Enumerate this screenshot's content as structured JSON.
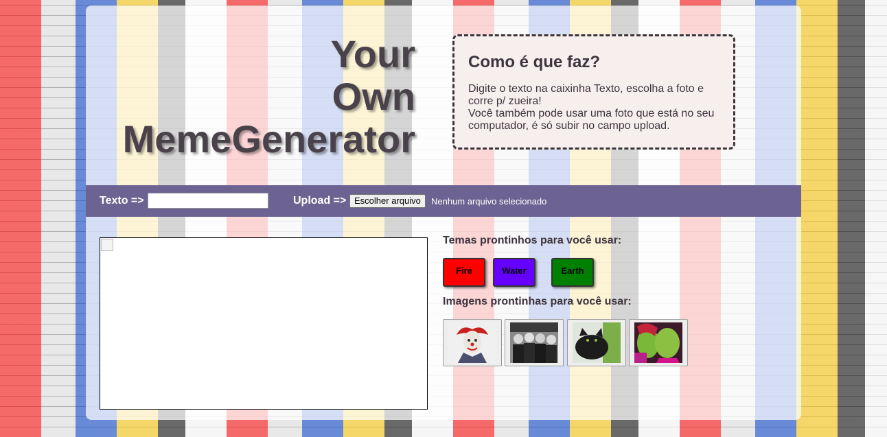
{
  "header": {
    "title_line1": "Your",
    "title_line2": "Own",
    "title_line3": "MemeGenerator"
  },
  "howto": {
    "heading": "Como é que faz?",
    "text": "Digite o texto na caixinha Texto, escolha a foto e corre p/ zueira!\nVocê também pode usar uma foto que está no seu computador, é só subir no campo upload."
  },
  "toolbar": {
    "text_label": "Texto =>",
    "text_value": "",
    "upload_label": "Upload =>",
    "file_button": "Escolher arquivo",
    "file_status": "Nenhum arquivo selecionado"
  },
  "themes": {
    "label": "Temas prontinhos para você usar:",
    "buttons": [
      {
        "label": "Fire",
        "color": "#ff0000",
        "text_color": "#000000"
      },
      {
        "label": "Water",
        "color": "#6600ff",
        "text_color": "#000000"
      },
      {
        "label": "Earth",
        "color": "#008000",
        "text_color": "#000000"
      }
    ]
  },
  "images": {
    "label": "Imagens prontinhas para você usar:",
    "thumbnails": [
      "clown-image",
      "nuns-image",
      "cat-image",
      "shrek-kiss-image"
    ]
  },
  "colors": {
    "toolbar_bg": "#6d6392",
    "text_dark": "#3e343e"
  }
}
